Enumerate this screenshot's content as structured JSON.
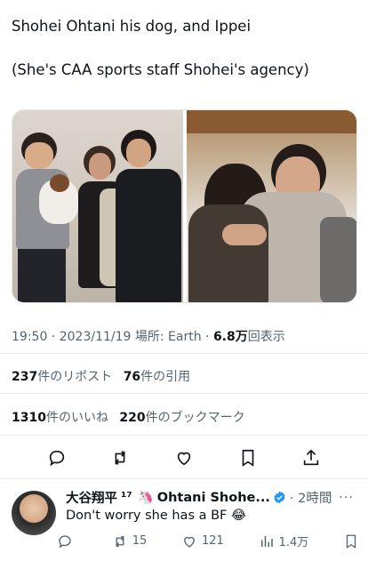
{
  "post": {
    "line1": "Shohei Ohtani his dog, and Ippei",
    "line2": "(She's CAA sports staff Shohei's agency)"
  },
  "meta": {
    "time": "19:50",
    "sep": " · ",
    "date": "2023/11/19",
    "location": " 場所: Earth · ",
    "views": "6.8万",
    "views_label": "回表示"
  },
  "stats": {
    "reposts": "237",
    "reposts_label": "件のリポスト",
    "quotes": "76",
    "quotes_label": "件の引用",
    "likes": "1310",
    "likes_label": "件のいいね",
    "bookmarks": "220",
    "bookmarks_label": "件のブックマーク"
  },
  "icons": {
    "reply": "reply-icon",
    "repost": "repost-icon",
    "like": "heart-icon",
    "bookmark": "bookmark-icon",
    "share": "share-icon",
    "views": "views-icon"
  },
  "reply": {
    "name": "大谷翔平",
    "name_suffix": "¹⁷",
    "unicorn": "🦄",
    "display": "Ohtani Shohe...",
    "time": "· 2時間",
    "more": "···",
    "text": "Don't worry she has a BF 😂",
    "reply_count": "",
    "repost_count": "15",
    "like_count": "121",
    "views_count": "1.4万"
  },
  "colors": {
    "text": "#0f1419",
    "secondary": "#536471",
    "verified": "#1d9bf0",
    "divider": "#e6ecf0"
  }
}
